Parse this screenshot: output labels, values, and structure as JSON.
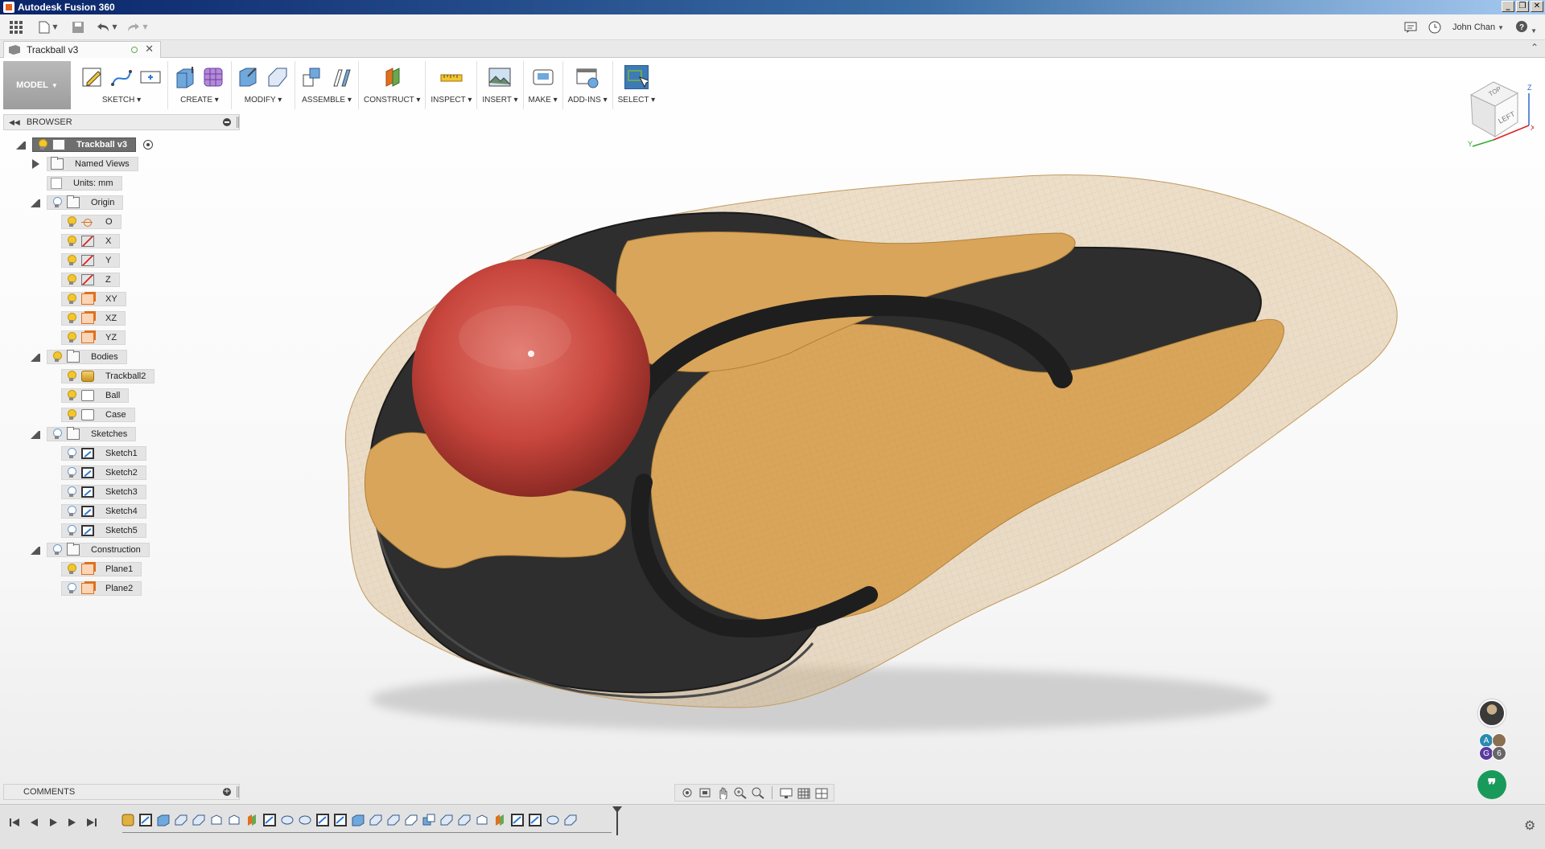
{
  "window": {
    "title": "Autodesk Fusion 360"
  },
  "appbar": {
    "user_name": "John Chan"
  },
  "document": {
    "tab_title": "Trackball v3"
  },
  "workspace": {
    "label": "MODEL"
  },
  "toolbar": {
    "groups": [
      {
        "label": "SKETCH"
      },
      {
        "label": "CREATE"
      },
      {
        "label": "MODIFY"
      },
      {
        "label": "ASSEMBLE"
      },
      {
        "label": "CONSTRUCT"
      },
      {
        "label": "INSPECT"
      },
      {
        "label": "INSERT"
      },
      {
        "label": "MAKE"
      },
      {
        "label": "ADD-INS"
      },
      {
        "label": "SELECT"
      }
    ]
  },
  "browser": {
    "header": "BROWSER",
    "root": "Trackball v3",
    "named_views": "Named Views",
    "units": "Units: mm",
    "origin": {
      "label": "Origin",
      "items": [
        "O",
        "X",
        "Y",
        "Z",
        "XY",
        "XZ",
        "YZ"
      ]
    },
    "bodies": {
      "label": "Bodies",
      "items": [
        "Trackball2",
        "Ball",
        "Case"
      ]
    },
    "sketches": {
      "label": "Sketches",
      "items": [
        "Sketch1",
        "Sketch2",
        "Sketch3",
        "Sketch4",
        "Sketch5"
      ]
    },
    "construction": {
      "label": "Construction",
      "items": [
        "Plane1",
        "Plane2"
      ]
    }
  },
  "viewcube": {
    "top": "TOP",
    "left": "LEFT",
    "axis_x": "X",
    "axis_y": "Y",
    "axis_z": "Z"
  },
  "comments": {
    "label": "COMMENTS"
  },
  "collaborators": {
    "a": "A",
    "g": "G",
    "count": "6"
  },
  "colors": {
    "accent": "#3d7ab8",
    "ball": "#c8463d",
    "mesh": "#d9a55a",
    "case": "#2f2f2f",
    "chat": "#1a9a5a"
  }
}
